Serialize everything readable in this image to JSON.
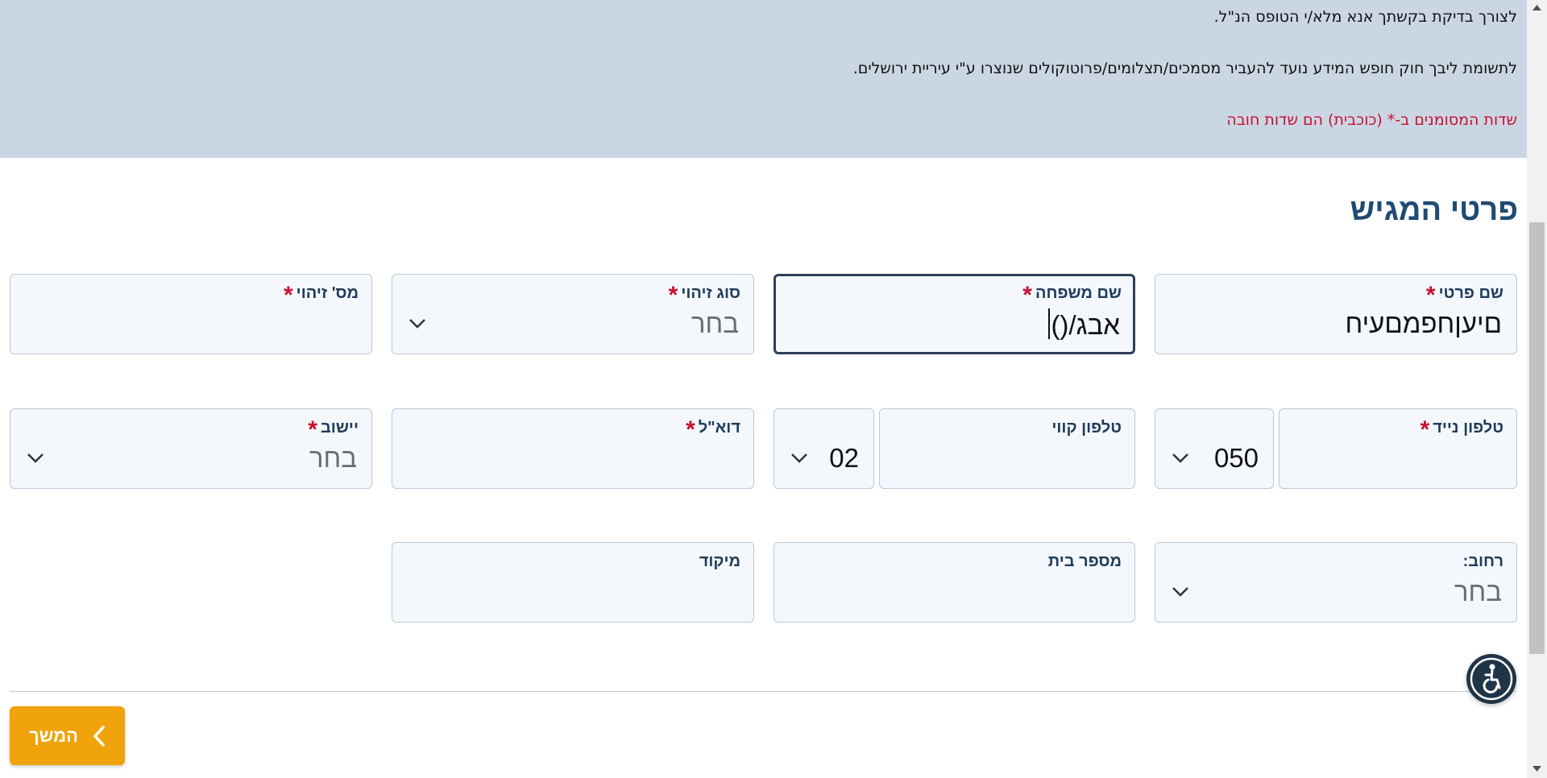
{
  "banner": {
    "line1": "לצורך בדיקת בקשתך אנא מלא/י הטופס הנ\"ל.",
    "line2": "לתשומת ליבך חוק חופש המידע נועד להעביר מסמכים/תצלומים/פרוטוקולים שנוצרו ע\"י עיריית ירושלים.",
    "required_note": "שדות המסומנים ב-* (כוכבית) הם שדות חובה"
  },
  "section": {
    "title": "פרטי המגיש"
  },
  "required_mark": "*",
  "fields": {
    "first_name": {
      "label": "שם פרטי",
      "value": "םיעןחפמםעיח"
    },
    "last_name": {
      "label": "שם משפחה",
      "value": "אבג/()"
    },
    "id_type": {
      "label": "סוג זיהוי",
      "value": "בחר"
    },
    "id_number": {
      "label": "מס' זיהוי",
      "value": ""
    },
    "mobile_phone": {
      "label": "טלפון נייד",
      "value": "",
      "prefix": "050"
    },
    "landline_phone": {
      "label": "טלפון קווי",
      "value": "",
      "prefix": "02"
    },
    "email": {
      "label": "דוא\"ל",
      "value": ""
    },
    "city": {
      "label": "יישוב",
      "value": "בחר"
    },
    "street": {
      "label": "רחוב:",
      "value": "בחר"
    },
    "house_number": {
      "label": "מספר בית",
      "value": ""
    },
    "zip_code": {
      "label": "מיקוד",
      "value": ""
    }
  },
  "buttons": {
    "continue_label": "המשך"
  },
  "icons": {
    "chevron": "chevron-down-icon",
    "continue": "chevron-left-icon",
    "accessibility": "accessibility-icon"
  },
  "colors": {
    "banner_bg": "#cbd6e4",
    "title": "#1f4a72",
    "required": "#c8102e",
    "button": "#f0a30a",
    "field_bg": "#f4f8fc"
  }
}
